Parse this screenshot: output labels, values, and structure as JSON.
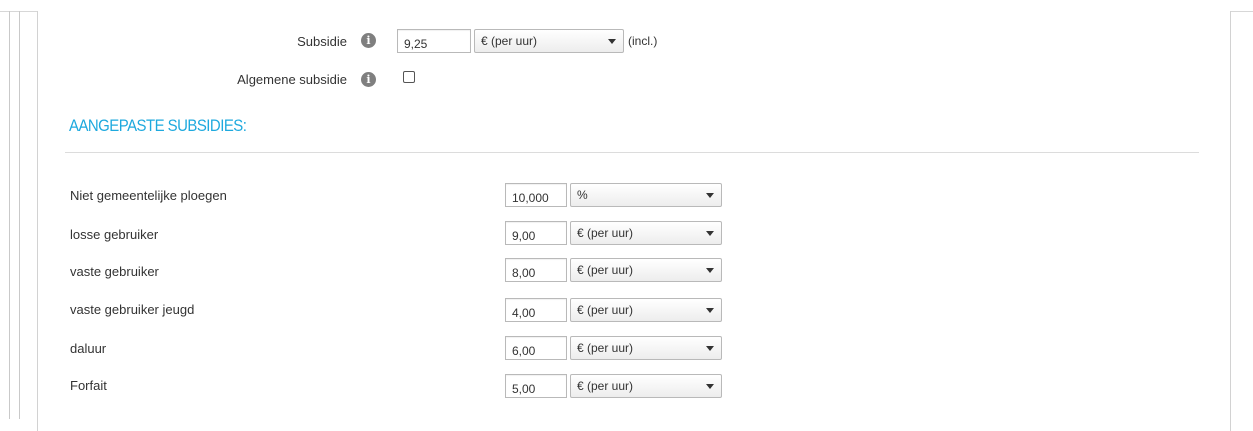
{
  "subsidie": {
    "label": "Subsidie",
    "value": "9,25",
    "unit": "€ (per uur)",
    "suffix": "(incl.)"
  },
  "algemene": {
    "label": "Algemene subsidie",
    "checked": false
  },
  "section_title": "AANGEPASTE SUBSIDIES:",
  "items": [
    {
      "label": "Niet gemeentelijke ploegen",
      "value": "10,000",
      "unit": "%"
    },
    {
      "label": "losse gebruiker",
      "value": "9,00",
      "unit": "€ (per uur)"
    },
    {
      "label": "vaste gebruiker",
      "value": "8,00",
      "unit": "€ (per uur)"
    },
    {
      "label": "vaste gebruiker jeugd",
      "value": "4,00",
      "unit": "€ (per uur)"
    },
    {
      "label": "daluur",
      "value": "6,00",
      "unit": "€ (per uur)"
    },
    {
      "label": "Forfait",
      "value": "5,00",
      "unit": "€ (per uur)"
    }
  ],
  "icons": {
    "info": "info-icon",
    "dropdown": "chevron-down-icon"
  },
  "colors": {
    "accent": "#1ea9de"
  }
}
